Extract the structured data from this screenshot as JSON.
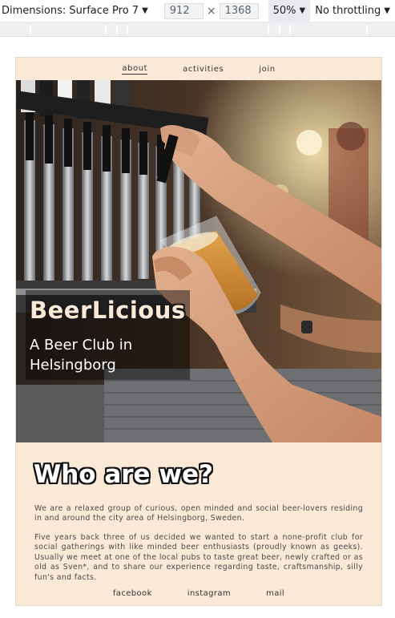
{
  "devtools": {
    "device_label": "Dimensions: Surface Pro 7",
    "width": "912",
    "height": "1368",
    "zoom": "50%",
    "throttling": "No throttling",
    "times": "×",
    "caret": "▼"
  },
  "nav": {
    "items": [
      "about",
      "activities",
      "join"
    ],
    "active": "about"
  },
  "hero": {
    "title": "BeerLicious",
    "subtitle": "A Beer Club in Helsingborg"
  },
  "section": {
    "heading": "Who are we?",
    "paragraph1": "We are a relaxed group of curious, open minded and social beer-lovers residing in and around the city area of Helsingborg, Sweden.",
    "paragraph2": "Five years back three of us decided we wanted to start a none-profit club for social gatherings with like minded beer enthusiasts (proudly known as geeks). Usually we meet at one of the local pubs to taste great beer, newly crafted or as old as Sven*, and to share our experience regarding taste, craftsmanship, silly fun's and facts."
  },
  "footer": {
    "links": [
      "facebook",
      "instagram",
      "mail"
    ]
  },
  "colors": {
    "page_bg": "#fbe9d7",
    "text": "#4a4a4a",
    "heading_fill": "#ffffff",
    "heading_outline": "#111111"
  }
}
